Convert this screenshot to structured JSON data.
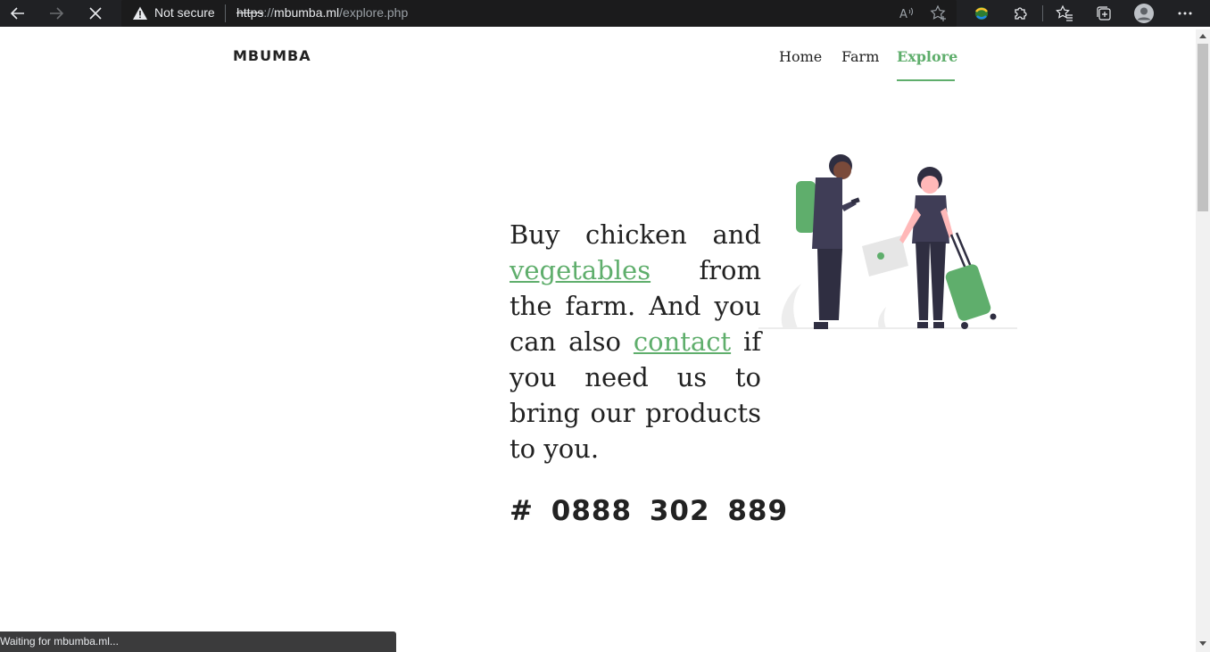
{
  "browser": {
    "security_label": "Not secure",
    "url": {
      "scheme": "https",
      "separator": "://",
      "host": "mbumba.ml",
      "path": "/explore.php"
    }
  },
  "site": {
    "brand": "MBUMBA",
    "nav": [
      {
        "label": "Home",
        "active": false
      },
      {
        "label": "Farm",
        "active": false
      },
      {
        "label": "Explore",
        "active": true
      }
    ]
  },
  "hero": {
    "text_1": "Buy chicken and",
    "link_1": "vegetables",
    "text_2": "from the farm. And you can also",
    "link_2": "contact",
    "text_3": "if you need us to bring our products to you.",
    "phone": "# 0888 302 889"
  },
  "status_bar": {
    "text": "Waiting for mbumba.ml..."
  },
  "colors": {
    "accent": "#5fae6c",
    "text": "#222222",
    "chrome": "#202124"
  },
  "icons": [
    "back-arrow-icon",
    "forward-arrow-icon",
    "stop-loading-icon",
    "warning-icon",
    "read-aloud-icon",
    "add-favorite-icon",
    "extension-colorful-icon",
    "extensions-puzzle-icon",
    "favorites-icon",
    "collections-icon",
    "profile-avatar-icon",
    "more-menu-icon"
  ]
}
